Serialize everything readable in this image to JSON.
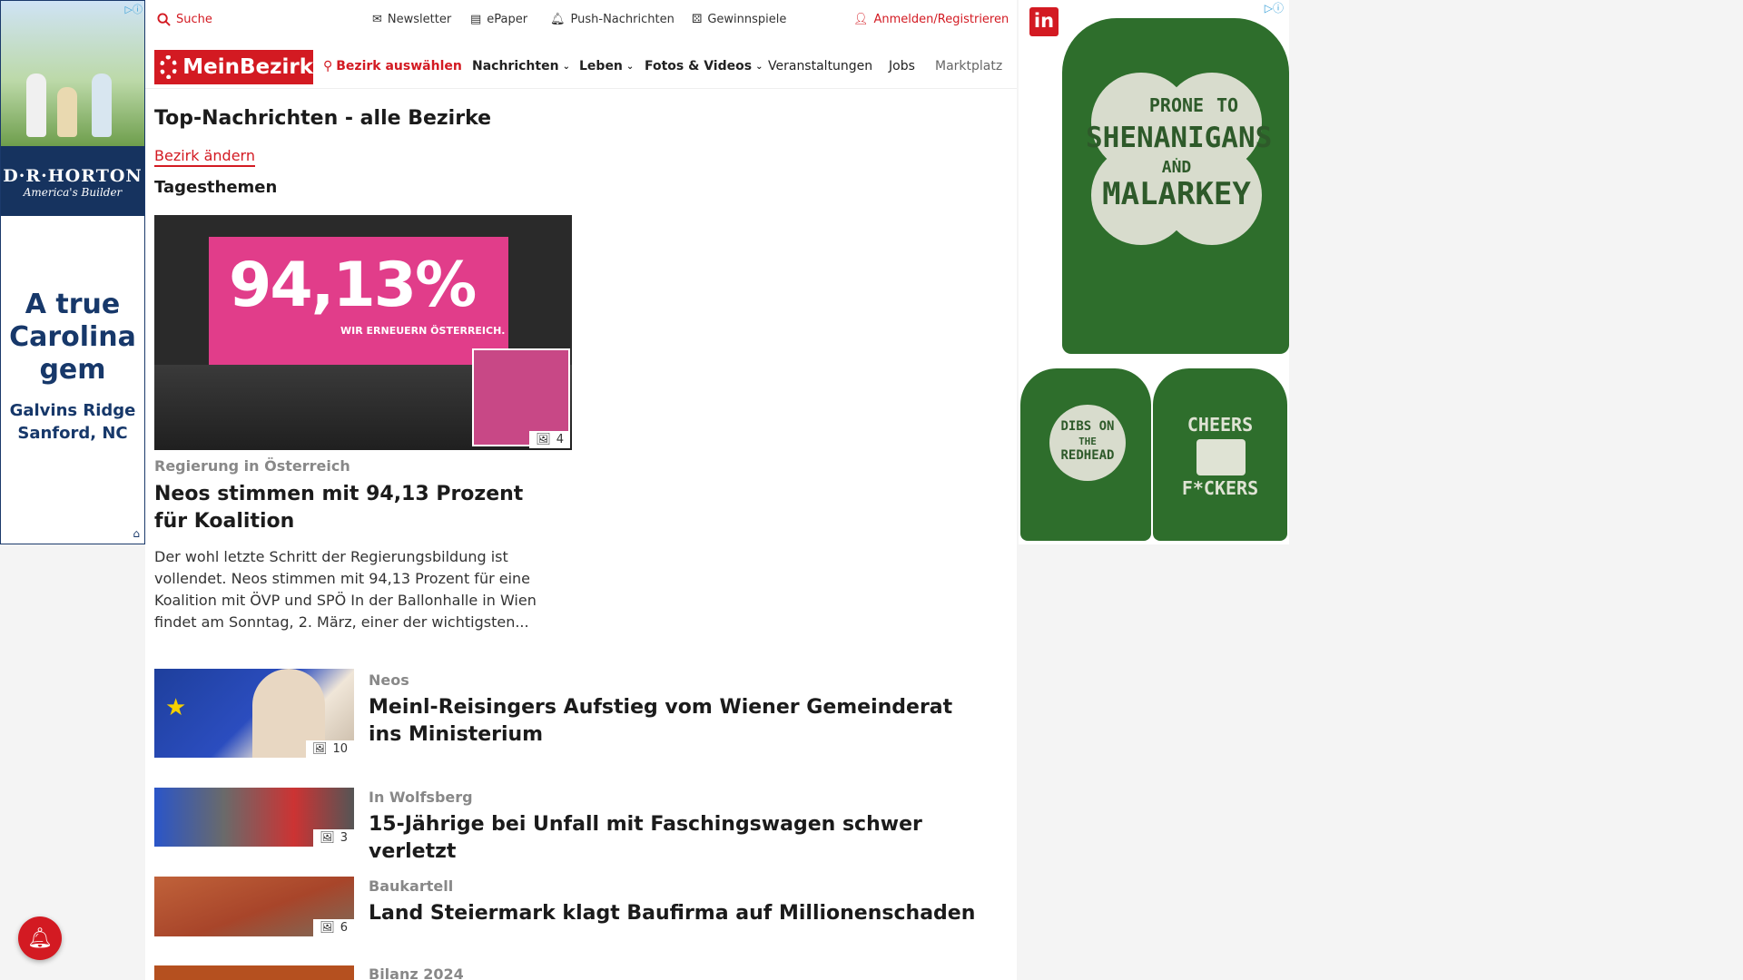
{
  "topbar": {
    "search": "Suche",
    "newsletter": "Newsletter",
    "epaper": "ePaper",
    "push": "Push-Nachrichten",
    "contests": "Gewinnspiele",
    "login": "Anmelden/Registrieren"
  },
  "nav": {
    "logo": "MeinBezirk",
    "select_district": "Bezirk auswählen",
    "items": [
      "Nachrichten",
      "Leben",
      "Fotos & Videos",
      "Veranstaltungen",
      "Jobs",
      "Marktplatz"
    ]
  },
  "page": {
    "title": "Top-Nachrichten - alle Bezirke",
    "change_district": "Bezirk ändern",
    "section": "Tagesthemen"
  },
  "hero": {
    "image_text_big": "94,13%",
    "image_text_small": "WIR ERNEUERN ÖSTERREICH.",
    "photo_count": "4",
    "kicker": "Regierung in Österreich",
    "headline": "Neos stimmen mit 94,13 Prozent für Koalition",
    "teaser": "Der wohl letzte Schritt der Regierungsbildung ist vollendet. Neos stimmen mit 94,13 Prozent für eine Koalition mit ÖVP und SPÖ In der Ballonhalle in Wien findet am Sonntag, 2. März, einer der wichtigsten..."
  },
  "articles": [
    {
      "kicker": "Neos",
      "headline": "Meinl-Reisingers Aufstieg vom Wiener Gemeinderat ins Ministerium",
      "photo_count": "10"
    },
    {
      "kicker": "In Wolfsberg",
      "headline": "15-Jährige bei Unfall mit Faschingswagen schwer verletzt",
      "photo_count": "3"
    },
    {
      "kicker": "Baukartell",
      "headline": "Land Steiermark klagt Baufirma auf Millionenschaden",
      "photo_count": "6"
    },
    {
      "kicker": "Bilanz 2024"
    }
  ],
  "ad_left": {
    "brand": "D·R·HORTON",
    "brand_sub": "America's Builder",
    "tagline": "A true Carolina gem",
    "location": "Galvins Ridge Sanford, NC"
  },
  "ad_right": {
    "logo": "in",
    "shirt1": [
      "PRONE",
      "TO",
      "SHENANIGANS",
      "AND",
      "MALARKEY"
    ],
    "shirt2": [
      "DIBS ON",
      "THE",
      "REDHEAD"
    ],
    "shirt3": [
      "CHEERS",
      "F*CKERS"
    ]
  },
  "colors": {
    "brand_red": "#d31a22",
    "ad_navy": "#16335f",
    "shirt_green": "#2e6e2c"
  }
}
